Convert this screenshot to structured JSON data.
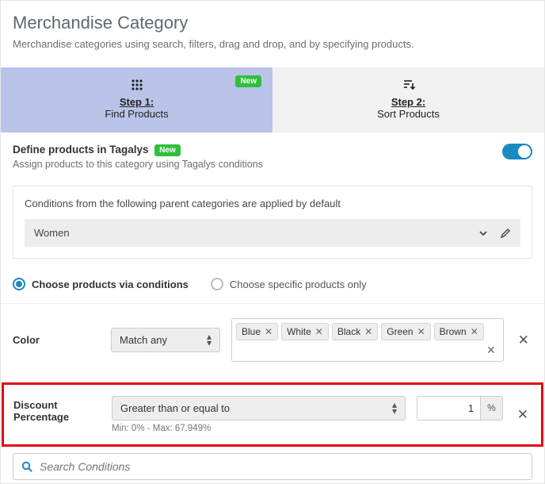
{
  "header": {
    "title": "Merchandise Category",
    "subtitle": "Merchandise categories using search, filters, drag and drop, and by specifying products."
  },
  "steps": {
    "step1": {
      "label": "Step 1:",
      "sub": "Find Products",
      "badge": "New"
    },
    "step2": {
      "label": "Step 2:",
      "sub": "Sort Products"
    }
  },
  "define": {
    "title": "Define products in Tagalys",
    "badge": "New",
    "desc": "Assign products to this category using Tagalys conditions"
  },
  "parent": {
    "title": "Conditions from the following parent categories are applied by default",
    "value": "Women"
  },
  "radios": {
    "a": "Choose products via conditions",
    "b": "Choose specific products only"
  },
  "color": {
    "label": "Color",
    "match": "Match any",
    "tags": [
      "Blue",
      "White",
      "Black",
      "Green",
      "Brown"
    ]
  },
  "discount": {
    "label": "Discount Percentage",
    "op": "Greater than or equal to",
    "value": "1",
    "unit": "%",
    "hint": "Min: 0% - Max: 67.949%"
  },
  "search": {
    "placeholder": "Search Conditions"
  }
}
